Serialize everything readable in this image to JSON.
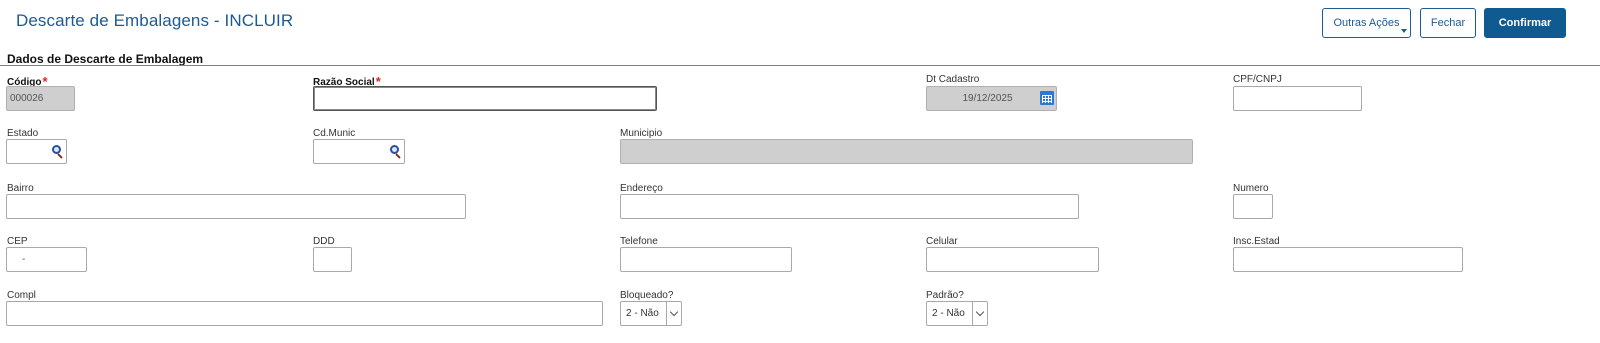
{
  "header": {
    "title": "Descarte de Embalagens - INCLUIR",
    "buttons": {
      "other_actions": "Outras Ações",
      "close": "Fechar",
      "confirm": "Confirmar"
    }
  },
  "section": {
    "title": "Dados de Descarte de Embalagem"
  },
  "fields": {
    "codigo": {
      "label": "Código",
      "value": "000026"
    },
    "razao_social": {
      "label": "Razão Social",
      "value": ""
    },
    "dt_cadastro": {
      "label": "Dt Cadastro",
      "value": "19/12/2025"
    },
    "cpf_cnpj": {
      "label": "CPF/CNPJ",
      "value": ""
    },
    "estado": {
      "label": "Estado",
      "value": ""
    },
    "cd_munic": {
      "label": "Cd.Munic",
      "value": ""
    },
    "municipio": {
      "label": "Municipio",
      "value": ""
    },
    "bairro": {
      "label": "Bairro",
      "value": ""
    },
    "endereco": {
      "label": "Endereço",
      "value": ""
    },
    "numero": {
      "label": "Numero",
      "value": ""
    },
    "cep": {
      "label": "CEP",
      "value": "-"
    },
    "ddd": {
      "label": "DDD",
      "value": ""
    },
    "telefone": {
      "label": "Telefone",
      "value": ""
    },
    "celular": {
      "label": "Celular",
      "value": ""
    },
    "insc_estad": {
      "label": "Insc.Estad",
      "value": ""
    },
    "compl": {
      "label": "Compl",
      "value": ""
    },
    "bloqueado": {
      "label": "Bloqueado?",
      "value": "2 - Não"
    },
    "padrao": {
      "label": "Padrão?",
      "value": "2 - Não"
    }
  },
  "required_marker": "*",
  "icons": {
    "lookup": "search-icon",
    "calendar": "calendar-icon",
    "dropdown": "chevron-down-icon"
  },
  "colors": {
    "title": "#1e5a94",
    "primary": "#0e5a91",
    "required": "#e0202a",
    "disabled_field": "#cfcfcf",
    "section_line": "#4a90c8"
  }
}
